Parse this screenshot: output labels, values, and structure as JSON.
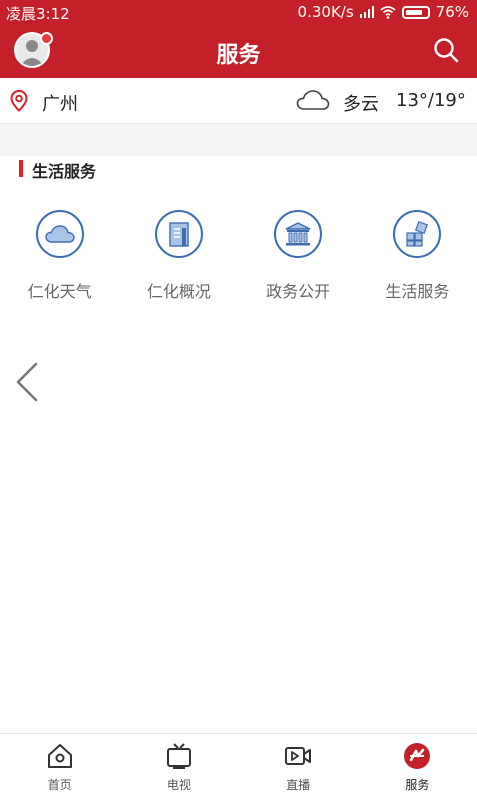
{
  "status_bar": {
    "time": "凌晨3:12",
    "network_speed": "0.30K/s",
    "battery": "76%"
  },
  "header": {
    "title": "服务",
    "icons": [
      "avatar",
      "search-icon"
    ]
  },
  "location_bar": {
    "city": "广州",
    "weather": "多云",
    "temperature": "13°/19°",
    "icons": [
      "location-pin-icon",
      "cloud-icon"
    ]
  },
  "section": {
    "title": "生活服务"
  },
  "services": [
    {
      "label": "仁化天气",
      "icon": "cloud-icon"
    },
    {
      "label": "仁化概况",
      "icon": "building-icon"
    },
    {
      "label": "政务公开",
      "icon": "government-icon"
    },
    {
      "label": "生活服务",
      "icon": "grid-squares-icon"
    }
  ],
  "tabs": [
    {
      "label": "首页",
      "icon": "home-icon"
    },
    {
      "label": "电视",
      "icon": "tv-icon"
    },
    {
      "label": "直播",
      "icon": "video-icon"
    },
    {
      "label": "服务",
      "icon": "service-icon",
      "active": true
    }
  ],
  "colors": {
    "brand_red": "#c3202a",
    "icon_blue": "#3d6fb0"
  }
}
